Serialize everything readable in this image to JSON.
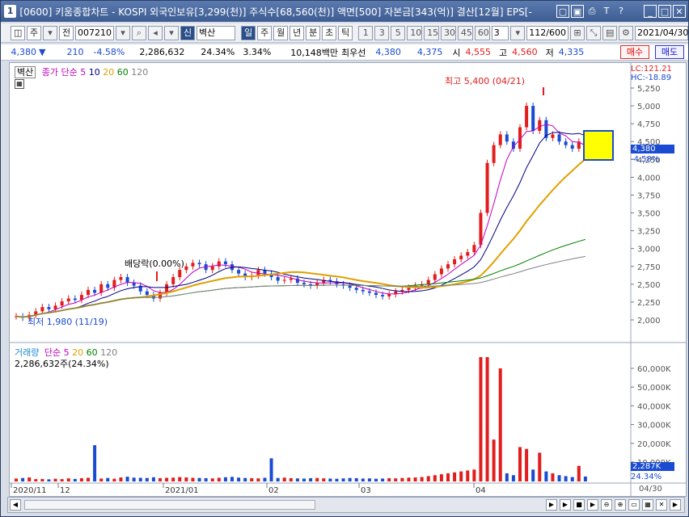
{
  "titlebar": {
    "badge": "1",
    "text": "[0600] 키움종합차트 - KOSPI 외국인보유[3,299(천)] 주식수[68,560(천)] 액면[500] 자본금[343(억)] 결산[12월] EPS[-"
  },
  "toolbar": {
    "period_type": "주",
    "period_mode": "전",
    "code": "007210",
    "name_tag": "신",
    "name": "벽산",
    "intervals": [
      "일",
      "주",
      "월",
      "년",
      "분",
      "초",
      "틱"
    ],
    "selected_interval": "일",
    "minutes": [
      "1",
      "3",
      "5",
      "10",
      "15",
      "30",
      "45",
      "60"
    ],
    "tick_value": "3",
    "count": "112/600",
    "date": "2021/04/30"
  },
  "infobar": {
    "price": "4,380",
    "arrow": "▼",
    "change": "210",
    "change_pct": "-4.58%",
    "volume": "2,286,632",
    "turnover_pct": "24.34%",
    "ratio": "3.34%",
    "amount": "10,148백만",
    "prio_label": "최우선",
    "ask": "4,380",
    "bid": "4,375",
    "open_label": "시",
    "open": "4,555",
    "high_label": "고",
    "high": "4,560",
    "low_label": "저",
    "low": "4,335",
    "buy_label": "매수",
    "sell_label": "매도"
  },
  "legend": {
    "stock": "벽산",
    "close_label": "종가 단순",
    "ma": [
      "5",
      "10",
      "20",
      "60",
      "120"
    ],
    "volume_label": "거래량",
    "vol_ma_label": "단순",
    "vol_ma": [
      "5",
      "20",
      "60",
      "120"
    ],
    "volume_value": "2,286,632주(24.34%)"
  },
  "annotations": {
    "high": "최고 5,400 (04/21)",
    "low": "최저 1,980 (11/19)",
    "dividend": "배당락(0.00%)"
  },
  "axis": {
    "lc": "LC:121.21",
    "hc": "HC:-18.89",
    "price_ticks": [
      "5,250",
      "5,000",
      "4,750",
      "4,500",
      "4,250",
      "4,000",
      "3,750",
      "3,500",
      "3,250",
      "3,000",
      "2,750",
      "2,500",
      "2,250",
      "2,000"
    ],
    "current_price": "4,380",
    "current_pct": "-4.58%",
    "volume_ticks": [
      "60,000K",
      "50,000K",
      "40,000K",
      "30,000K",
      "20,000K",
      "10,000K"
    ],
    "current_volume": "2,287K",
    "current_vol_pct": "24.34%",
    "x_ticks": [
      "2020/11",
      "12",
      "2021/01",
      "02",
      "03",
      "04"
    ],
    "x_end": "04/30"
  },
  "colors": {
    "up": "#e31c1c",
    "down": "#1a4bd1",
    "ma5": "#c000c0",
    "ma10": "#000080",
    "ma20": "#e0a000",
    "ma60": "#008000",
    "ma120": "#808080"
  }
}
